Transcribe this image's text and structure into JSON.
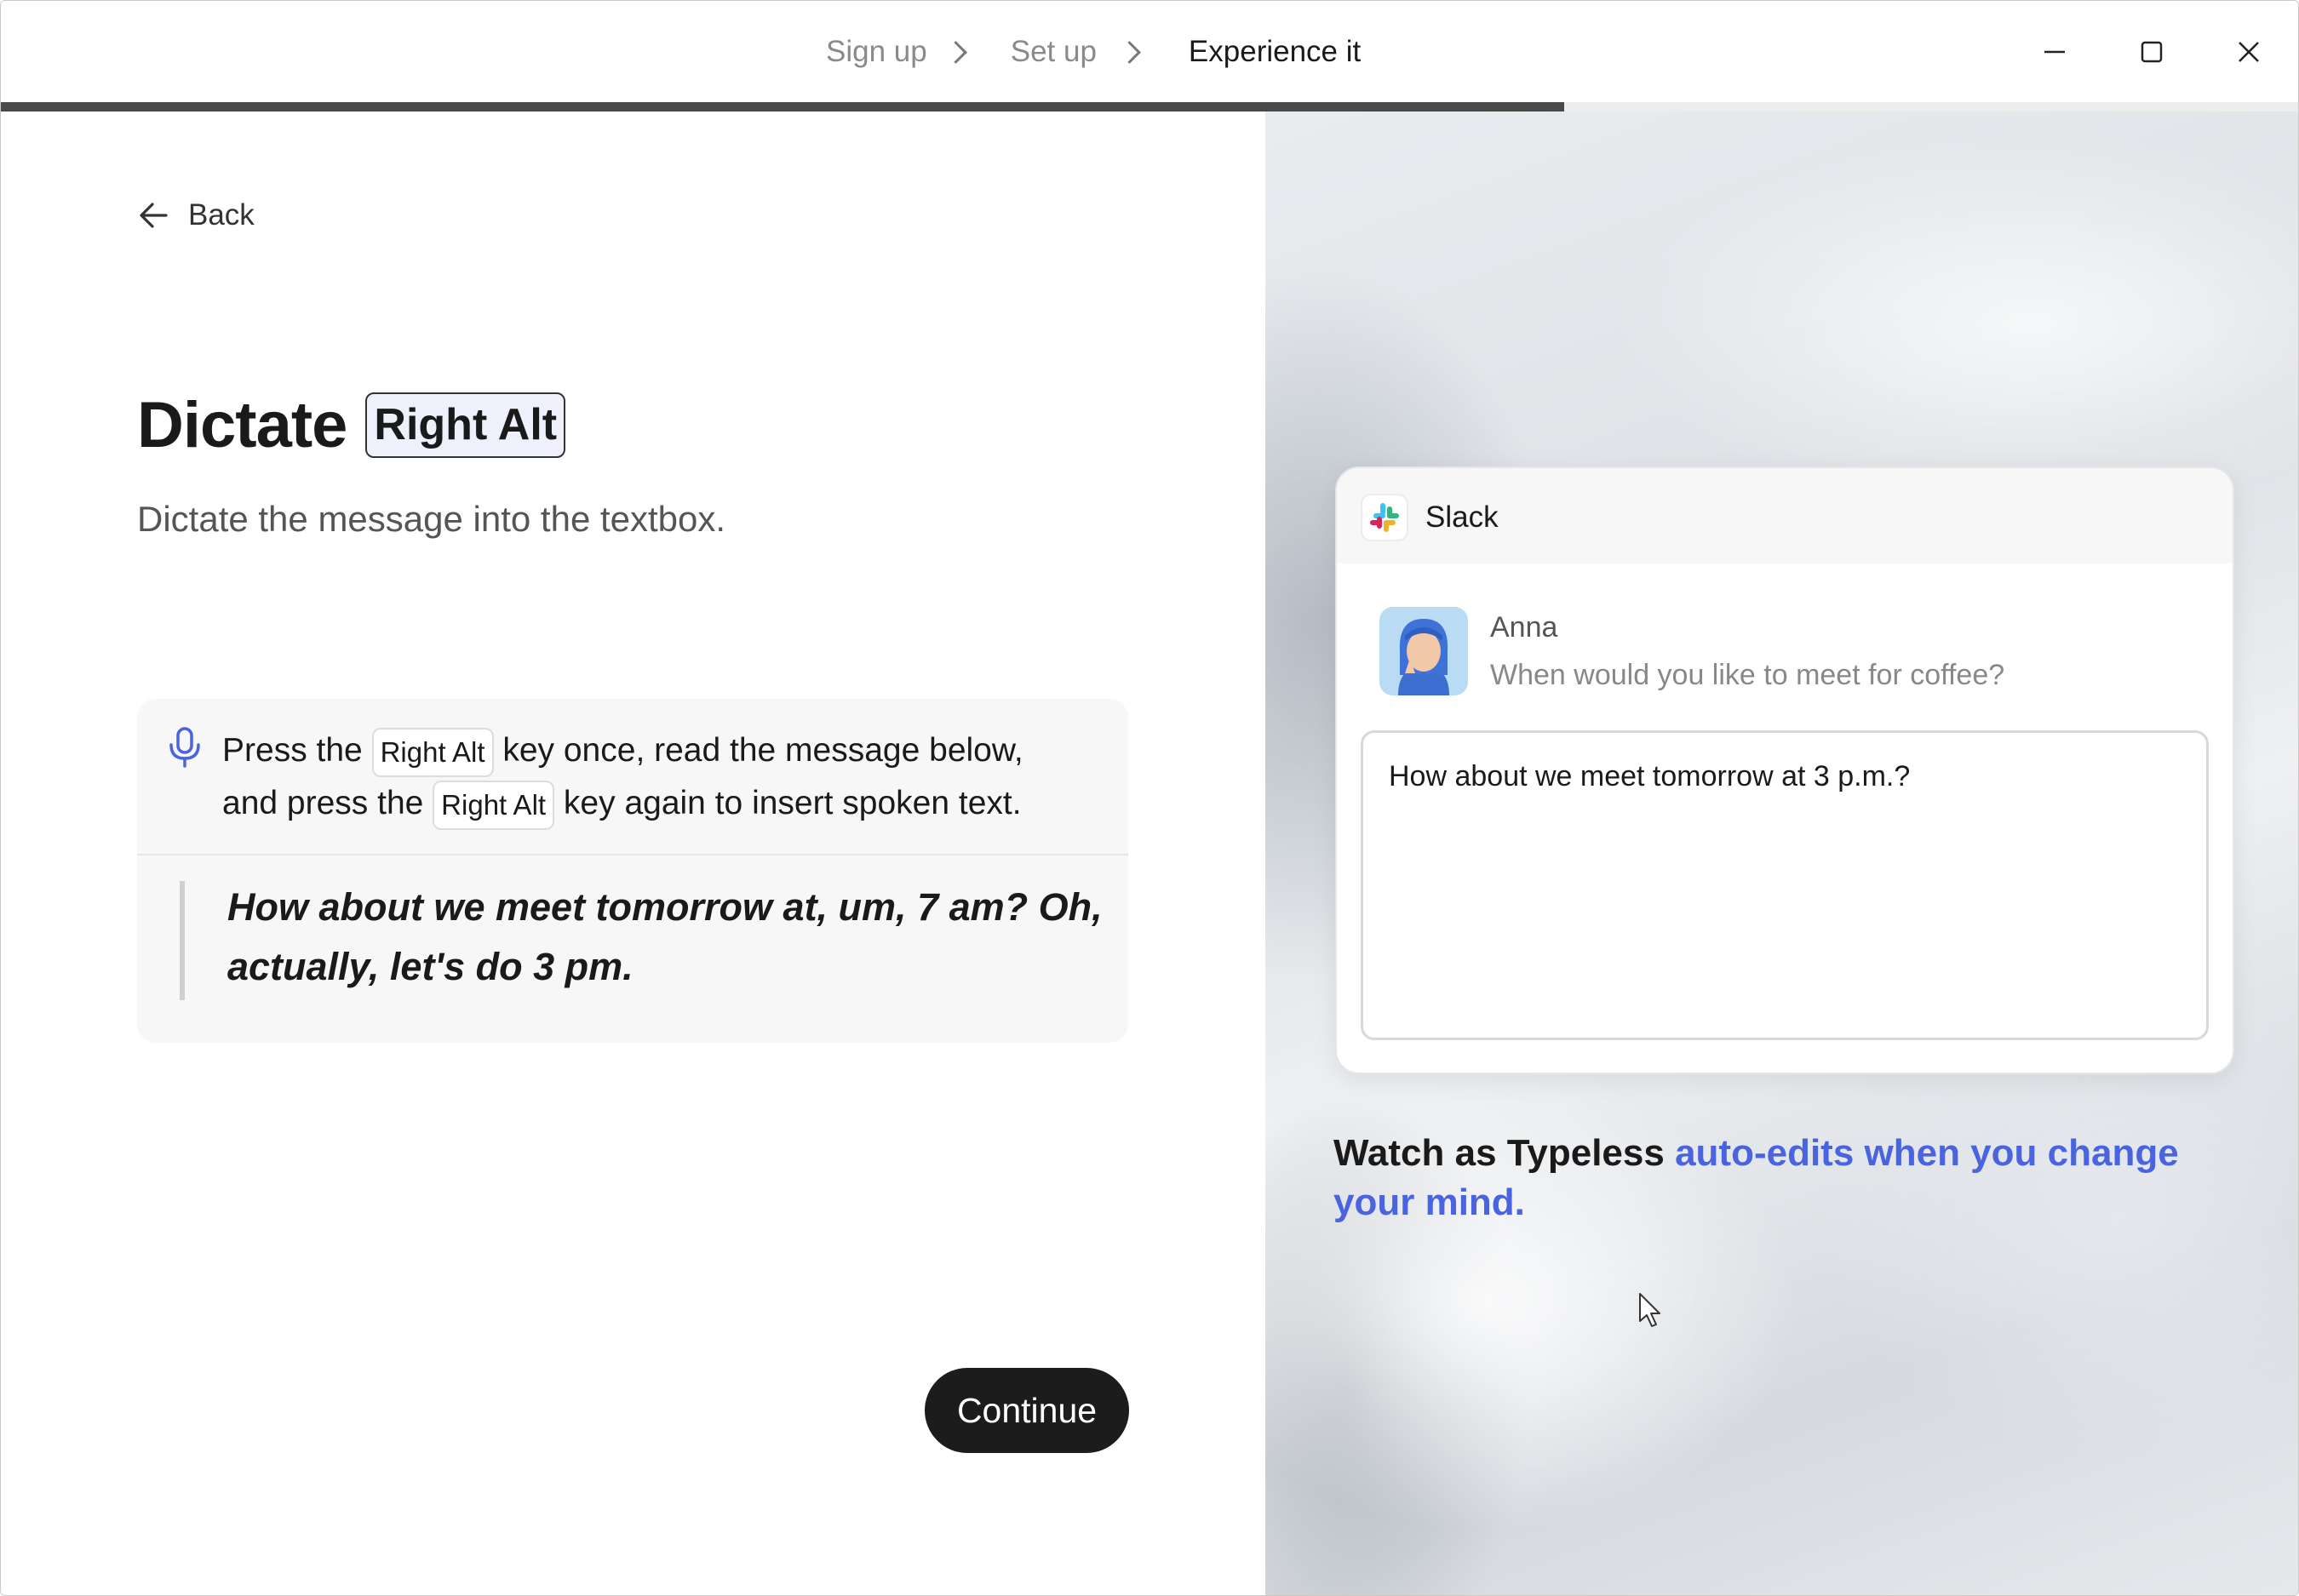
{
  "titlebar": {
    "steps": [
      "Sign up",
      "Set up",
      "Experience it"
    ],
    "active_step": 2,
    "progress": 0.68
  },
  "left": {
    "back_label": "Back",
    "title": "Dictate",
    "hotkey": "Right Alt",
    "subtitle": "Dictate the message into the textbox.",
    "instruction": {
      "part1": "Press the",
      "key1": "Right Alt",
      "part2": "key once, read the message below,",
      "part3": "and press the",
      "key2": "Right Alt",
      "part4": "key again to insert spoken text."
    },
    "quote": "How about we meet tomorrow at, um, 7 am? Oh, actually, let's do 3 pm.",
    "continue_label": "Continue"
  },
  "right": {
    "app_name": "Slack",
    "sender": "Anna",
    "message": "When would you like to meet for coffee?",
    "textbox_value": "How about we meet tomorrow at 3 p.m.?",
    "tagline_plain": "Watch as Typeless",
    "tagline_highlight": "auto-edits when you change your mind."
  },
  "icons": {
    "back": "arrow-left-icon",
    "mic": "microphone-icon",
    "minimize": "minimize-icon",
    "maximize": "maximize-icon",
    "close": "close-icon",
    "slack": "slack-logo-icon"
  },
  "colors": {
    "accent": "#4a63df",
    "button_bg": "#1c1c1c",
    "progress_fill": "#4a4a4a"
  }
}
